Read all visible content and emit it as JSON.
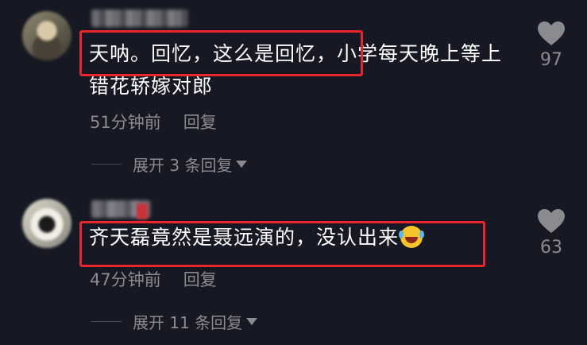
{
  "comments": [
    {
      "text": "天呐。回忆，这么是回忆，小学每天晚上等上错花轿嫁对郎",
      "time": "51分钟前",
      "reply_label": "回复",
      "expand_label": "展开 3 条回复",
      "likes": "97",
      "highlighted": true
    },
    {
      "text": "齐天磊竟然是聂远演的，没认出来",
      "emoji": "laughing-tears-emoji",
      "time": "47分钟前",
      "reply_label": "回复",
      "expand_label": "展开 11 条回复",
      "likes": "63",
      "highlighted": true
    }
  ],
  "colors": {
    "background": "#161823",
    "text": "#ffffff",
    "muted": "#8a8b91",
    "highlight": "#e8262b"
  },
  "icons": {
    "like": "heart-icon",
    "expand": "caret-down-icon"
  }
}
